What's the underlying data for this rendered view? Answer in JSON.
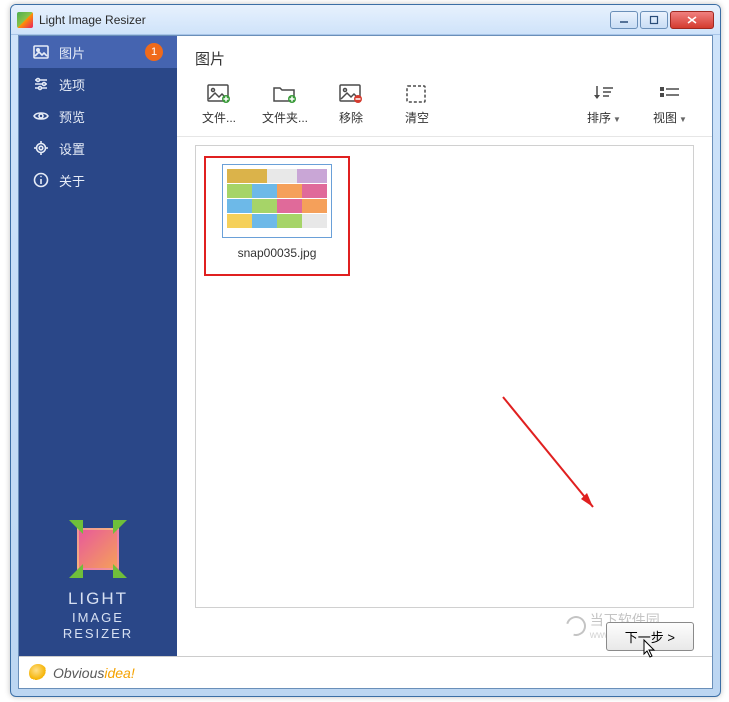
{
  "window": {
    "title": "Light Image Resizer"
  },
  "sidebar": {
    "items": [
      {
        "label": "图片",
        "badge": "1"
      },
      {
        "label": "选项"
      },
      {
        "label": "预览"
      },
      {
        "label": "设置"
      },
      {
        "label": "关于"
      }
    ]
  },
  "brand": {
    "line1": "LIGHT",
    "line2": "IMAGE",
    "line3": "RESIZER"
  },
  "obvious": {
    "text": "Obvious",
    "accent": "idea!"
  },
  "main": {
    "header": "图片"
  },
  "toolbar": {
    "file": "文件...",
    "folder": "文件夹...",
    "remove": "移除",
    "clear": "清空",
    "sort": "排序",
    "view": "视图"
  },
  "item": {
    "filename": "snap00035.jpg"
  },
  "footer": {
    "next": "下一步 >"
  },
  "watermark": {
    "text": "当下软件园",
    "url": "www.downxia.com"
  }
}
